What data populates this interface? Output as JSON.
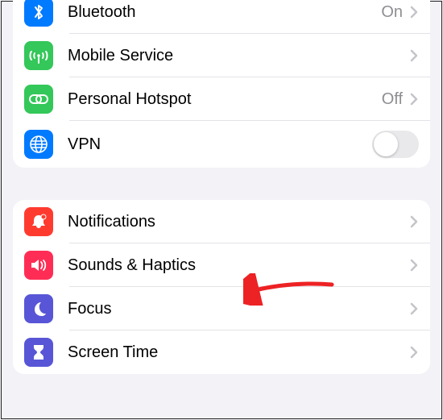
{
  "group1": {
    "bluetooth": {
      "label": "Bluetooth",
      "status": "On",
      "icon_color": "#007aff"
    },
    "mobile_service": {
      "label": "Mobile Service",
      "icon_color": "#34c759"
    },
    "personal_hotspot": {
      "label": "Personal Hotspot",
      "status": "Off",
      "icon_color": "#34c759"
    },
    "vpn": {
      "label": "VPN",
      "icon_color": "#007aff",
      "toggled": false
    }
  },
  "group2": {
    "notifications": {
      "label": "Notifications",
      "icon_color": "#ff3b30"
    },
    "sounds_haptics": {
      "label": "Sounds & Haptics",
      "icon_color": "#ff2d55"
    },
    "focus": {
      "label": "Focus",
      "icon_color": "#5856d6"
    },
    "screen_time": {
      "label": "Screen Time",
      "icon_color": "#5856d6"
    }
  },
  "annotation": {
    "arrow_color": "#ed2224"
  }
}
